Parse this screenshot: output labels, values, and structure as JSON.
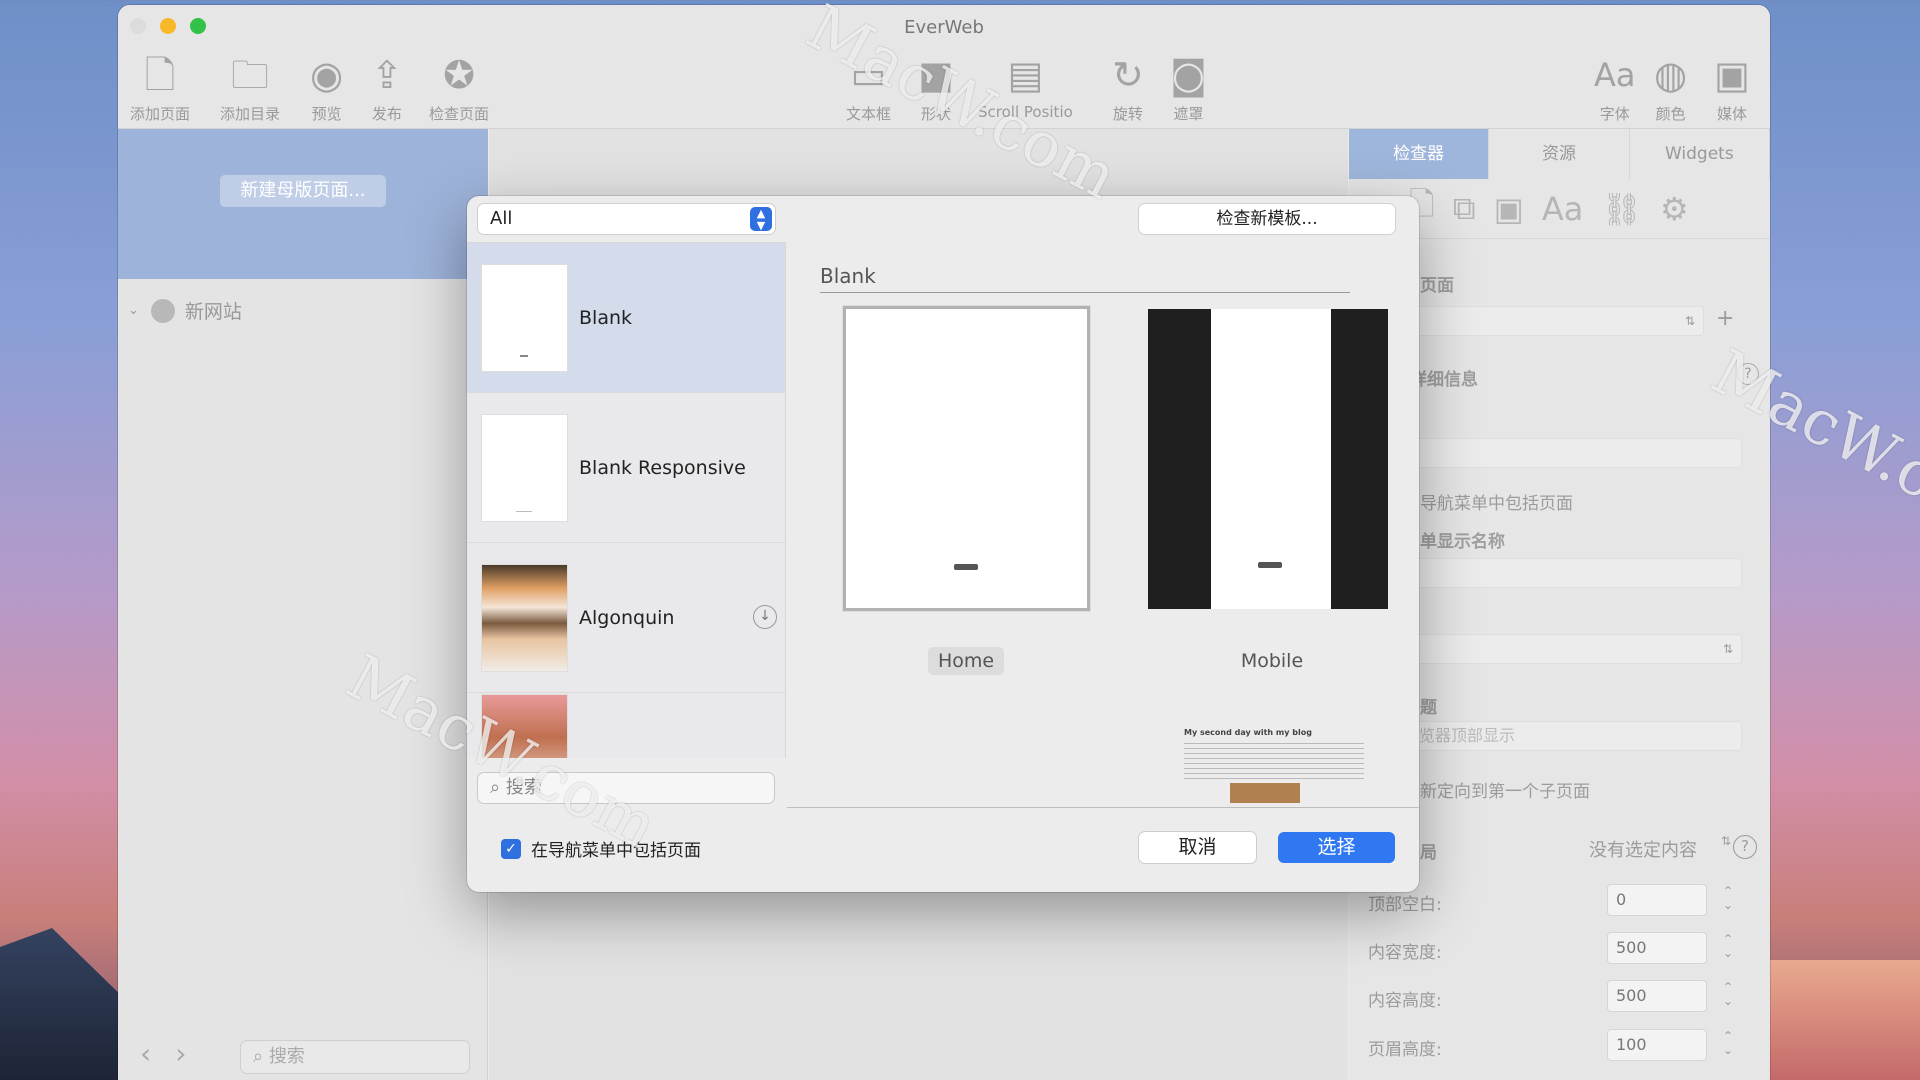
{
  "window": {
    "title": "EverWeb"
  },
  "toolbar": {
    "left": [
      {
        "label": "添加页面",
        "icon": "add-page-icon"
      },
      {
        "label": "添加目录",
        "icon": "add-folder-icon"
      },
      {
        "label": "预览",
        "icon": "eye-icon"
      },
      {
        "label": "发布",
        "icon": "share-icon"
      },
      {
        "label": "检查页面",
        "icon": "check-badge-icon"
      }
    ],
    "center": [
      {
        "label": "文本框",
        "icon": "textbox-icon"
      },
      {
        "label": "形状",
        "icon": "shape-icon"
      },
      {
        "label": "Scroll Positio",
        "icon": "scroll-position-icon"
      },
      {
        "label": "旋转",
        "icon": "rotate-icon"
      },
      {
        "label": "遮罩",
        "icon": "mask-icon"
      }
    ],
    "right": [
      {
        "label": "字体",
        "icon": "font-icon"
      },
      {
        "label": "颜色",
        "icon": "palette-icon"
      },
      {
        "label": "媒体",
        "icon": "media-icon"
      }
    ]
  },
  "left_panel": {
    "new_master_button": "新建母版页面...",
    "site_name": "新网站",
    "search_placeholder": "搜索"
  },
  "right_panel": {
    "tabs": [
      "检查器",
      "资源",
      "Widgets"
    ],
    "section_page": "页面",
    "details": "详细信息",
    "include_nav": "导航菜单中包括页面",
    "menu_display_name": "单显示名称",
    "title_label": "题",
    "title_placeholder": "览器顶部显示",
    "redirect": "新定向到第一个子页面",
    "layout": "局",
    "no_selection": "没有选定内容",
    "fields": [
      {
        "label": "顶部空白:",
        "value": "0"
      },
      {
        "label": "内容宽度:",
        "value": "500"
      },
      {
        "label": "内容高度:",
        "value": "500"
      },
      {
        "label": "页眉高度:",
        "value": "100"
      }
    ]
  },
  "dialog": {
    "filter": "All",
    "check_new_templates": "检查新模板...",
    "templates": [
      {
        "name": "Blank"
      },
      {
        "name": "Blank Responsive"
      },
      {
        "name": "Algonquin"
      }
    ],
    "search_placeholder": "搜索",
    "include_in_nav": "在导航菜单中包括页面",
    "include_checked": true,
    "preview_title": "Blank",
    "preview_pages": [
      "Home",
      "Mobile"
    ],
    "blog_title": "My second day with my blog",
    "cancel": "取消",
    "select": "选择"
  },
  "watermark": "MacW.com",
  "colors": {
    "accent": "#2f78f2",
    "selected_row": "#d4dcec",
    "close": "#e0e0e0",
    "minimize": "#f7b92a",
    "zoom": "#33c148"
  }
}
